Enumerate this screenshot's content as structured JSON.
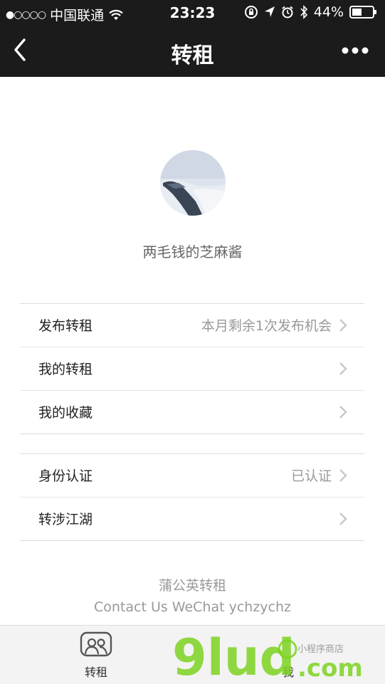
{
  "status_bar": {
    "signal_dots": "●○○○○",
    "carrier": "中国联通",
    "time": "23:23",
    "battery": "44%"
  },
  "nav": {
    "title": "转租"
  },
  "profile": {
    "name": "两毛钱的芝麻酱"
  },
  "menu_group_1": [
    {
      "label": "发布转租",
      "value": "本月剩余1次发布机会"
    },
    {
      "label": "我的转租",
      "value": ""
    },
    {
      "label": "我的收藏",
      "value": ""
    }
  ],
  "menu_group_2": [
    {
      "label": "身份认证",
      "value": "已认证"
    },
    {
      "label": "转涉江湖",
      "value": ""
    }
  ],
  "footer": {
    "brand": "蒲公英转租",
    "contact": "Contact Us WeChat ychzychz"
  },
  "tabbar": {
    "tab1_label": "转租",
    "tab2_label": "我"
  },
  "watermark": {
    "main": "9lud",
    "suffix": ".com",
    "tagline": "小程序商店"
  },
  "colors": {
    "header_bg": "#1b1b1b",
    "watermark_green": "#7ed321"
  }
}
